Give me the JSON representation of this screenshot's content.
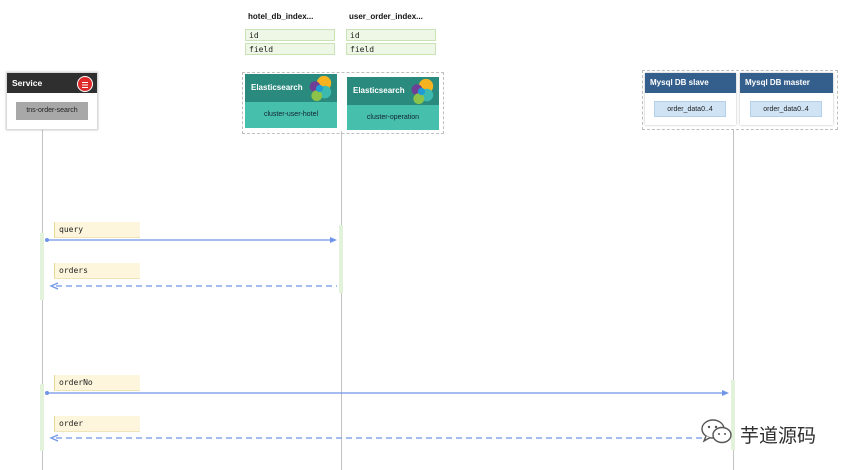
{
  "indexes": [
    {
      "title": "hotel_db_index...",
      "fields": [
        "id",
        "field"
      ]
    },
    {
      "title": "user_order_index...",
      "fields": [
        "id",
        "field"
      ]
    }
  ],
  "service": {
    "title": "Service",
    "icon": "database-icon",
    "label": "tns-order-search"
  },
  "elasticsearch": [
    {
      "title": "Elasticsearch",
      "cluster": "cluster-user-hotel"
    },
    {
      "title": "Elasticsearch",
      "cluster": "cluster-operation"
    }
  ],
  "mysql": [
    {
      "title": "Mysql DB  slave",
      "table": "order_data0..4"
    },
    {
      "title": "Mysql DB  master",
      "table": "order_data0..4"
    }
  ],
  "messages": [
    {
      "label": "query",
      "kind": "request"
    },
    {
      "label": "orders",
      "kind": "response"
    },
    {
      "label": "orderNo",
      "kind": "request"
    },
    {
      "label": "order",
      "kind": "response"
    }
  ],
  "watermark": {
    "text": "芋道源码",
    "icon": "wechat-icon"
  },
  "colors": {
    "message_line": "#6f95e8",
    "es_header": "#2a8a7d",
    "es_body": "#47bfad",
    "db_header": "#345f8c",
    "service_header": "#2f2f2f",
    "index_row": "#eef7e6",
    "label_bg": "#fdf6dc"
  }
}
